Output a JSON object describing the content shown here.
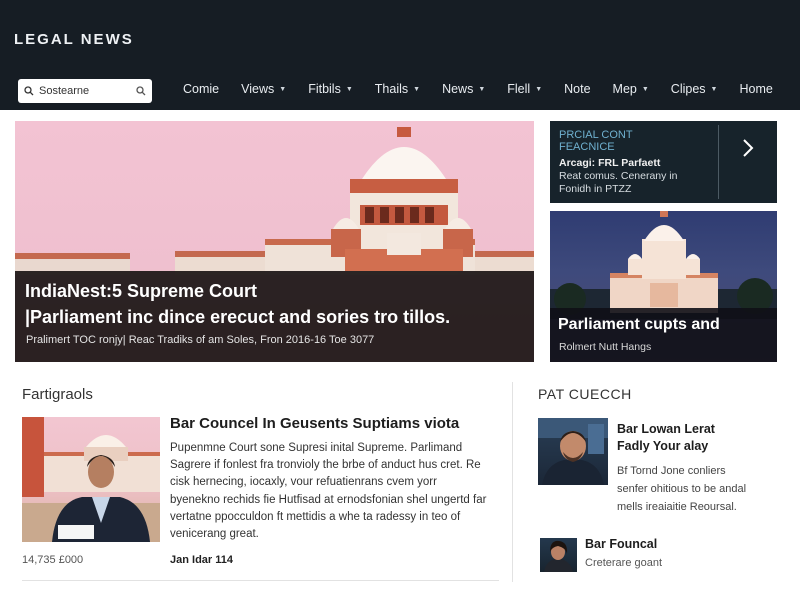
{
  "site": {
    "brand": "LEGAL NEWS"
  },
  "search": {
    "value": "Sostearne"
  },
  "nav": [
    {
      "label": "Comie",
      "has_dropdown": false
    },
    {
      "label": "Views",
      "has_dropdown": true
    },
    {
      "label": "Fitbils",
      "has_dropdown": true
    },
    {
      "label": "Thails",
      "has_dropdown": true
    },
    {
      "label": "News",
      "has_dropdown": true
    },
    {
      "label": "Flell",
      "has_dropdown": true
    },
    {
      "label": "Note",
      "has_dropdown": false
    },
    {
      "label": "Mep",
      "has_dropdown": true
    },
    {
      "label": "Clipes",
      "has_dropdown": true
    },
    {
      "label": "Home",
      "has_dropdown": false
    }
  ],
  "hero": {
    "title_line1": "IndiaNest:5 Supreme Court",
    "title_line2": "|Parliament inc dince erecuct and sories tro tillos.",
    "meta": "Pralimert TOC ronjy| Reac Tradiks of am Soles, Fron 2016-16 Toe 3077"
  },
  "promo": {
    "heading_line1": "PRCIAL CONT",
    "heading_line2": "FEACNICE",
    "sub_line1": "Arcagi: FRL Parfaett",
    "sub_line2": "Reat comus. Cenerany in",
    "sub_line3": "Fonidh in PTZZ"
  },
  "side_story": {
    "title": "Parliament cupts and",
    "subtitle": "Rolmert Nutt Hangs"
  },
  "section": {
    "title": "Fartigraols"
  },
  "article": {
    "title": "Bar Councel In Geusents Suptiams viota",
    "body": "Pupenmne Court sone Supresi inital Supreme. Parlimand Sagrere if fonlest fra tronvioly the brbe of anduct hus cret. Re cisk hernecing, iocaxly, vour refuatienrans cvem yorr byenekno rechids fie Hutfisad at ernodsfonian shel ungertd far vertatne ppocculdon ft mettidis a whe ta radessy in teo of venicerang great.",
    "count": "14,735 £000",
    "date": "Jan Idar 114"
  },
  "right_column": {
    "title": "PAT CUECCH",
    "item1": {
      "title_line1": "Bar Lowan Lerat",
      "title_line2": "Fadly Your alay",
      "body_line1": "Bf  Tornd Jone conliers",
      "body_line2": "senfer ohitious to be andal",
      "body_line3": "mells ireaiaitie Reoursal."
    },
    "item2": {
      "title": "Bar Founcal",
      "subtitle": "Creterare goant"
    }
  },
  "colors": {
    "header_bg": "#161d24",
    "promo_accent": "#6fb0cf",
    "hero_sky": "#f3c3d3"
  }
}
